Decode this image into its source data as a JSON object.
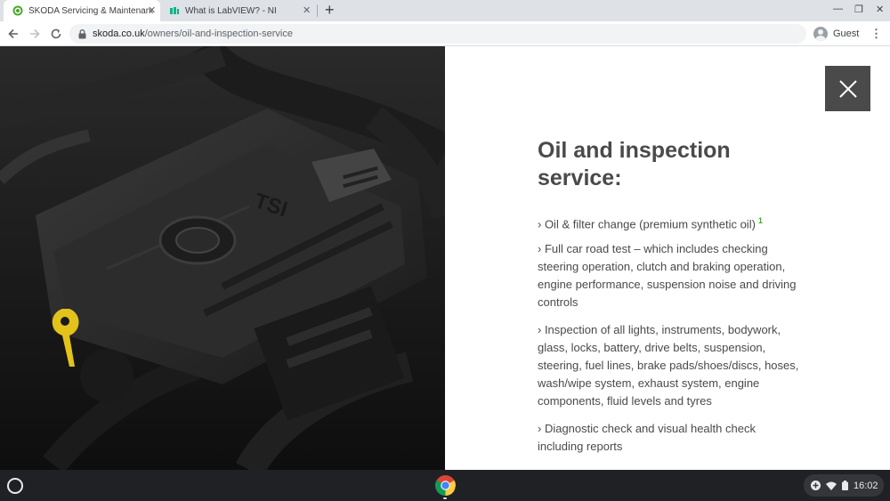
{
  "browser": {
    "tabs": [
      {
        "title": "ŠKODA Servicing & Maintenance",
        "active": true,
        "favicon": "skoda-logo-icon"
      },
      {
        "title": "What is LabVIEW? - NI",
        "active": false,
        "favicon": "ni-logo-icon"
      }
    ],
    "new_tab": "+",
    "url_domain": "skoda.co.uk",
    "url_path": "/owners/oil-and-inspection-service",
    "profile_label": "Guest"
  },
  "page": {
    "image_alt": "Skoda TSI engine bay",
    "heading": "Oil and inspection service:",
    "items": [
      "› Oil & filter change (premium synthetic oil)",
      "› Full car road test – which includes checking steering operation, clutch and braking operation, engine performance, suspension noise and driving controls",
      "› Inspection of all lights, instruments, bodywork, glass, locks, battery, drive belts, suspension, steering, fuel lines, brake pads/shoes/discs, hoses, wash/wipe system, exhaust system, engine components, fluid levels and tyres",
      "› Diagnostic check and visual health check including reports"
    ],
    "footnote_mark": "1"
  },
  "shelf": {
    "time": "16:02"
  },
  "colors": {
    "accent_green": "#4ba82e",
    "text_dark": "#4a4a4a",
    "close_bg": "#4a4a4a"
  }
}
